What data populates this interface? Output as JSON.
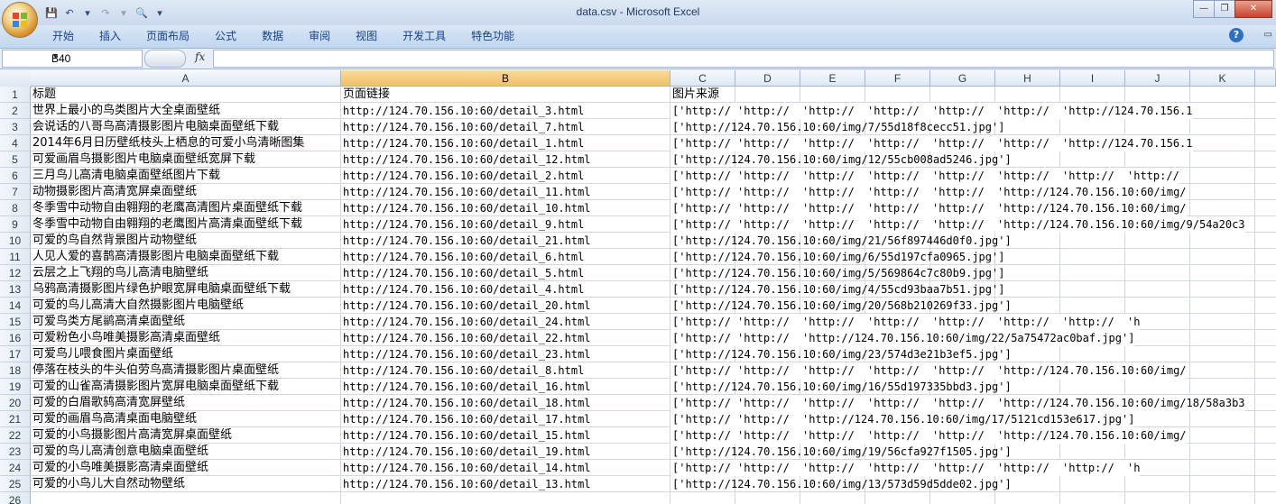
{
  "window": {
    "title": "data.csv - Microsoft Excel"
  },
  "ribbon": {
    "tabs": [
      "开始",
      "插入",
      "页面布局",
      "公式",
      "数据",
      "审阅",
      "视图",
      "开发工具",
      "特色功能"
    ]
  },
  "formula_bar": {
    "name_box": "B40",
    "fx": "fx",
    "formula": ""
  },
  "columns": [
    "A",
    "B",
    "C",
    "D",
    "E",
    "F",
    "G",
    "H",
    "I",
    "J",
    "K"
  ],
  "selected_column": "B",
  "header_row": [
    "标题",
    "页面链接",
    "图片来源"
  ],
  "rows": [
    {
      "title": "世界上最小的鸟类图片大全桌面壁纸",
      "link": "http://124.70.156.10:60/detail_3.html",
      "images": [
        "['http://",
        "'http://",
        "'http://",
        "'http://",
        "'http://",
        "'http://",
        "'http://124.70.156.1"
      ]
    },
    {
      "title": "会说话的八哥鸟高清摄影图片电脑桌面壁纸下载",
      "link": "http://124.70.156.10:60/detail_7.html",
      "images": [
        "['http://124.70.156.10:60/img/7/55d18f8cecc51.jpg']"
      ]
    },
    {
      "title": "2014年6月日历壁纸枝头上栖息的可爱小鸟清晰图集",
      "link": "http://124.70.156.10:60/detail_1.html",
      "images": [
        "['http://",
        "'http://",
        "'http://",
        "'http://",
        "'http://",
        "'http://",
        "'http://124.70.156.1"
      ]
    },
    {
      "title": "可爱画眉鸟摄影图片电脑桌面壁纸宽屏下载",
      "link": "http://124.70.156.10:60/detail_12.html",
      "images": [
        "['http://124.70.156.10:60/img/12/55cb008ad5246.jpg']"
      ]
    },
    {
      "title": "三月鸟儿高清电脑桌面壁纸图片下载",
      "link": "http://124.70.156.10:60/detail_2.html",
      "images": [
        "['http://",
        "'http://",
        "'http://",
        "'http://",
        "'http://",
        "'http://",
        "'http://",
        "'http://"
      ]
    },
    {
      "title": "动物摄影图片高清宽屏桌面壁纸",
      "link": "http://124.70.156.10:60/detail_11.html",
      "images": [
        "['http://",
        "'http://",
        "'http://",
        "'http://",
        "'http://",
        "'http://124.70.156.10:60/img/"
      ]
    },
    {
      "title": "冬季雪中动物自由翱翔的老鹰高清图片桌面壁纸下载",
      "link": "http://124.70.156.10:60/detail_10.html",
      "images": [
        "['http://",
        "'http://",
        "'http://",
        "'http://",
        "'http://",
        "'http://124.70.156.10:60/img/"
      ]
    },
    {
      "title": "冬季雪中动物自由翱翔的老鹰图片高清桌面壁纸下载",
      "link": "http://124.70.156.10:60/detail_9.html",
      "images": [
        "['http://",
        "'http://",
        "'http://",
        "'http://",
        "'http://",
        "'http://124.70.156.10:60/img/9/54a20c3"
      ]
    },
    {
      "title": "可爱的鸟自然背景图片动物壁纸",
      "link": "http://124.70.156.10:60/detail_21.html",
      "images": [
        "['http://124.70.156.10:60/img/21/56f897446d0f0.jpg']"
      ]
    },
    {
      "title": "人见人爱的喜鹊高清摄影图片电脑桌面壁纸下载",
      "link": "http://124.70.156.10:60/detail_6.html",
      "images": [
        "['http://124.70.156.10:60/img/6/55d197cfa0965.jpg']"
      ]
    },
    {
      "title": "云层之上飞翔的鸟儿高清电脑壁纸",
      "link": "http://124.70.156.10:60/detail_5.html",
      "images": [
        "['http://124.70.156.10:60/img/5/569864c7c80b9.jpg']"
      ]
    },
    {
      "title": "乌鸦高清摄影图片绿色护眼宽屏电脑桌面壁纸下载",
      "link": "http://124.70.156.10:60/detail_4.html",
      "images": [
        "['http://124.70.156.10:60/img/4/55cd93baa7b51.jpg']"
      ]
    },
    {
      "title": "可爱的鸟儿高清大自然摄影图片电脑壁纸",
      "link": "http://124.70.156.10:60/detail_20.html",
      "images": [
        "['http://124.70.156.10:60/img/20/568b210269f33.jpg']"
      ]
    },
    {
      "title": "可爱鸟类方尾鹟高清桌面壁纸",
      "link": "http://124.70.156.10:60/detail_24.html",
      "images": [
        "['http://",
        "'http://",
        "'http://",
        "'http://",
        "'http://",
        "'http://",
        "'http://",
        "'h"
      ]
    },
    {
      "title": "可爱粉色小鸟唯美摄影高清桌面壁纸",
      "link": "http://124.70.156.10:60/detail_22.html",
      "images": [
        "['http://",
        "'http://",
        "'http://124.70.156.10:60/img/22/5a75472ac0baf.jpg']"
      ]
    },
    {
      "title": "可爱鸟儿喂食图片桌面壁纸",
      "link": "http://124.70.156.10:60/detail_23.html",
      "images": [
        "['http://124.70.156.10:60/img/23/574d3e21b3ef5.jpg']"
      ]
    },
    {
      "title": "停落在枝头的牛头伯劳鸟高清摄影图片桌面壁纸",
      "link": "http://124.70.156.10:60/detail_8.html",
      "images": [
        "['http://",
        "'http://",
        "'http://",
        "'http://",
        "'http://",
        "'http://124.70.156.10:60/img/"
      ]
    },
    {
      "title": "可爱的山雀高清摄影图片宽屏电脑桌面壁纸下载",
      "link": "http://124.70.156.10:60/detail_16.html",
      "images": [
        "['http://124.70.156.10:60/img/16/55d197335bbd3.jpg']"
      ]
    },
    {
      "title": "可爱的白眉歌鸫高清宽屏壁纸",
      "link": "http://124.70.156.10:60/detail_18.html",
      "images": [
        "['http://",
        "'http://",
        "'http://",
        "'http://",
        "'http://",
        "'http://124.70.156.10:60/img/18/58a3b3"
      ]
    },
    {
      "title": "可爱的画眉鸟高清桌面电脑壁纸",
      "link": "http://124.70.156.10:60/detail_17.html",
      "images": [
        "['http://",
        "'http://",
        "'http://124.70.156.10:60/img/17/5121cd153e617.jpg']"
      ]
    },
    {
      "title": "可爱的小鸟摄影图片高清宽屏桌面壁纸",
      "link": "http://124.70.156.10:60/detail_15.html",
      "images": [
        "['http://",
        "'http://",
        "'http://",
        "'http://",
        "'http://",
        "'http://124.70.156.10:60/img/"
      ]
    },
    {
      "title": "可爱的鸟儿高清创意电脑桌面壁纸",
      "link": "http://124.70.156.10:60/detail_19.html",
      "images": [
        "['http://124.70.156.10:60/img/19/56cfa927f1505.jpg']"
      ]
    },
    {
      "title": "可爱的小鸟唯美摄影高清桌面壁纸",
      "link": "http://124.70.156.10:60/detail_14.html",
      "images": [
        "['http://",
        "'http://",
        "'http://",
        "'http://",
        "'http://",
        "'http://",
        "'http://",
        "'h"
      ]
    },
    {
      "title": "可爱的小鸟儿大自然动物壁纸",
      "link": "http://124.70.156.10:60/detail_13.html",
      "images": [
        "['http://124.70.156.10:60/img/13/573d59d5dde02.jpg']"
      ]
    }
  ],
  "row_numbers": [
    "1",
    "2",
    "3",
    "4",
    "5",
    "6",
    "7",
    "8",
    "9",
    "10",
    "11",
    "12",
    "13",
    "14",
    "15",
    "16",
    "17",
    "18",
    "19",
    "20",
    "21",
    "22",
    "23",
    "24",
    "25",
    "26"
  ]
}
